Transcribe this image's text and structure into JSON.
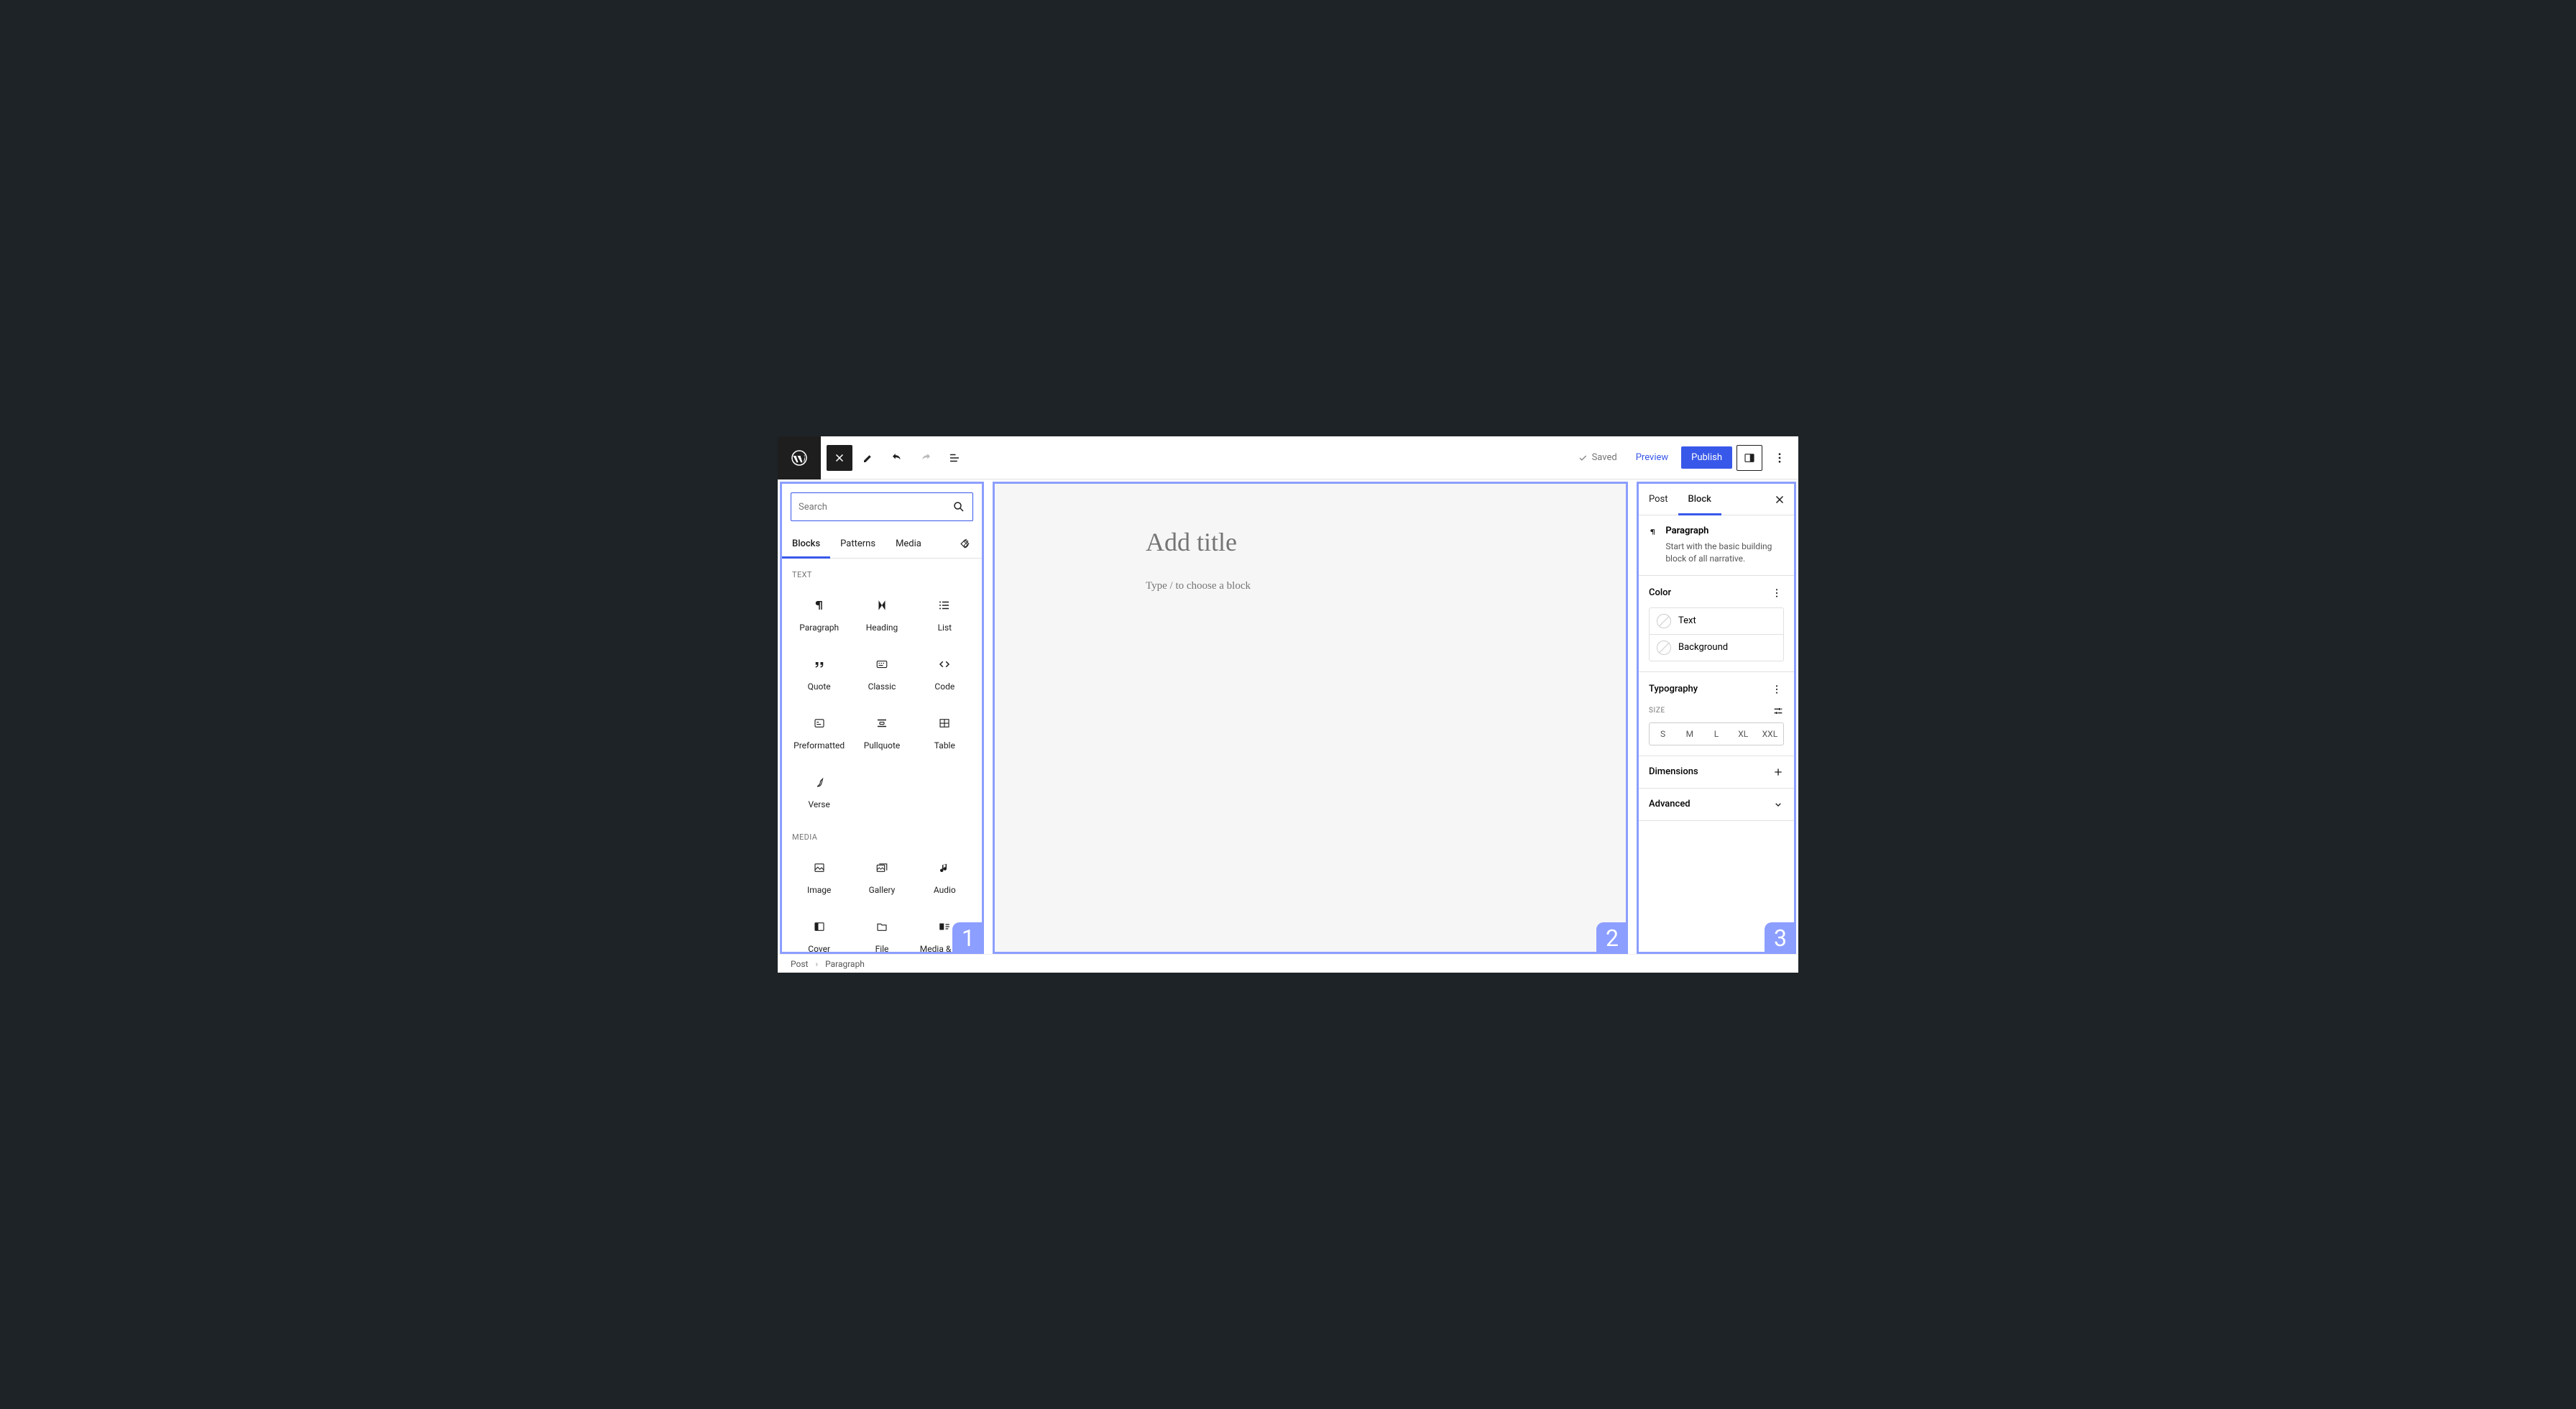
{
  "toolbar": {
    "saved_label": "Saved",
    "preview_label": "Preview",
    "publish_label": "Publish"
  },
  "inserter": {
    "search_placeholder": "Search",
    "tabs": {
      "blocks": "Blocks",
      "patterns": "Patterns",
      "media": "Media"
    },
    "categories": {
      "text": {
        "label": "Text",
        "items": [
          "Paragraph",
          "Heading",
          "List",
          "Quote",
          "Classic",
          "Code",
          "Preformatted",
          "Pullquote",
          "Table",
          "Verse"
        ]
      },
      "media": {
        "label": "Media",
        "items": [
          "Image",
          "Gallery",
          "Audio",
          "Cover",
          "File",
          "Media & Text"
        ]
      }
    }
  },
  "canvas": {
    "title_placeholder": "Add title",
    "paragraph_placeholder": "Type / to choose a block"
  },
  "settings": {
    "tabs": {
      "post": "Post",
      "block": "Block"
    },
    "block": {
      "name": "Paragraph",
      "description": "Start with the basic building block of all narrative."
    },
    "color": {
      "title": "Color",
      "items": [
        "Text",
        "Background"
      ]
    },
    "typography": {
      "title": "Typography",
      "size_label": "Size",
      "sizes": [
        "S",
        "M",
        "L",
        "XL",
        "XXL"
      ]
    },
    "dimensions_label": "Dimensions",
    "advanced_label": "Advanced"
  },
  "breadcrumb": [
    "Post",
    "Paragraph"
  ],
  "annotation_numbers": {
    "left": "1",
    "mid": "2",
    "right": "3"
  }
}
